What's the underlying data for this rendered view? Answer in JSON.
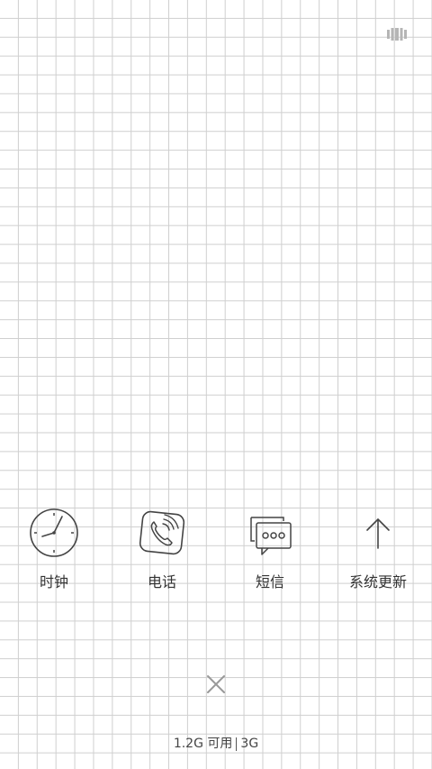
{
  "top_right": {
    "icon": "recent-apps-icon"
  },
  "apps": [
    {
      "label": "时钟",
      "icon": "clock-icon"
    },
    {
      "label": "电话",
      "icon": "phone-icon"
    },
    {
      "label": "短信",
      "icon": "message-icon"
    },
    {
      "label": "系统更新",
      "icon": "arrow-up-icon"
    }
  ],
  "close": {
    "icon": "close-icon"
  },
  "memory": {
    "available": "1.2G 可用",
    "total": "3G"
  },
  "colors": {
    "grid_line": "#cfcfcf",
    "background": "#ffffff",
    "icon_stroke": "#444444"
  }
}
